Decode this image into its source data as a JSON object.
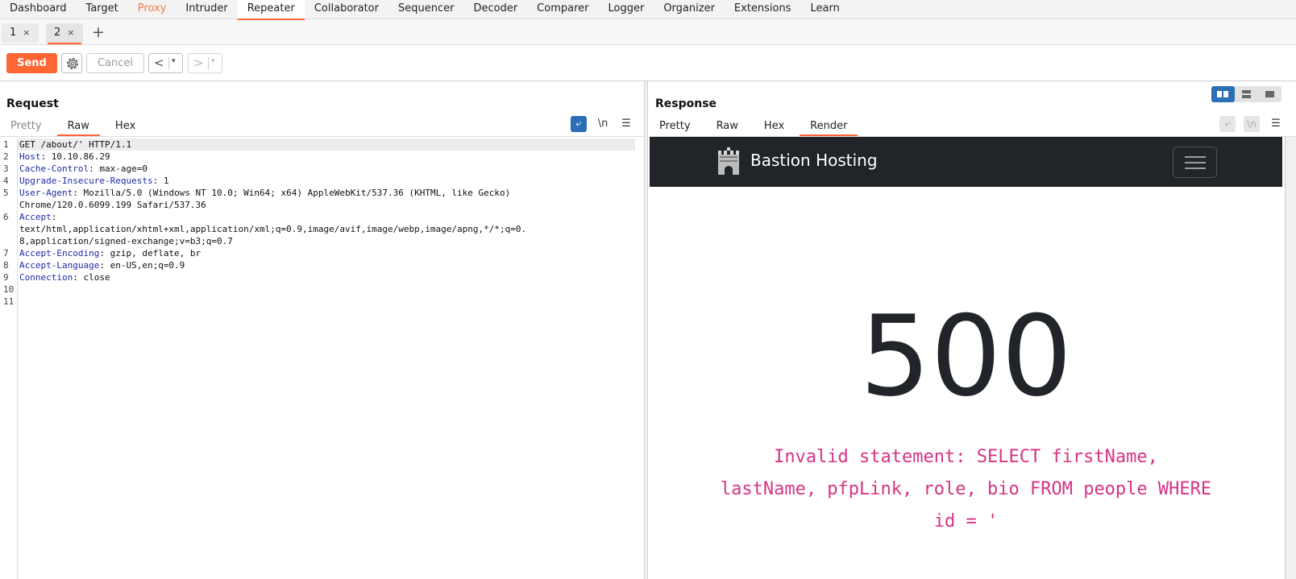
{
  "menu": [
    "Dashboard",
    "Target",
    "Proxy",
    "Intruder",
    "Repeater",
    "Collaborator",
    "Sequencer",
    "Decoder",
    "Comparer",
    "Logger",
    "Organizer",
    "Extensions",
    "Learn"
  ],
  "request_tabs": [
    {
      "label": "1",
      "close": "×"
    },
    {
      "label": "2",
      "close": "×"
    }
  ],
  "add_tab": "+",
  "toolbar": {
    "send": "Send",
    "cancel": "Cancel",
    "back": "<",
    "forward": ">",
    "drop": "▾"
  },
  "request": {
    "title": "Request",
    "tabs": [
      "Pretty",
      "Raw",
      "Hex"
    ],
    "newline_label": "\\n",
    "menu_icon": "☰",
    "lines": [
      {
        "n": "1",
        "name": "",
        "value": "GET /about/' HTTP/1.1"
      },
      {
        "n": "2",
        "name": "Host",
        "value": ": 10.10.86.29"
      },
      {
        "n": "3",
        "name": "Cache-Control",
        "value": ": max-age=0"
      },
      {
        "n": "4",
        "name": "Upgrade-Insecure-Requests",
        "value": ": 1"
      },
      {
        "n": "5",
        "name": "User-Agent",
        "value": ": Mozilla/5.0 (Windows NT 10.0; Win64; x64) AppleWebKit/537.36 (KHTML, like Gecko)"
      },
      {
        "n": "",
        "name": "",
        "value": "Chrome/120.0.6099.199 Safari/537.36"
      },
      {
        "n": "6",
        "name": "Accept",
        "value": ":"
      },
      {
        "n": "",
        "name": "",
        "value": "text/html,application/xhtml+xml,application/xml;q=0.9,image/avif,image/webp,image/apng,*/*;q=0."
      },
      {
        "n": "",
        "name": "",
        "value": "8,application/signed-exchange;v=b3;q=0.7"
      },
      {
        "n": "7",
        "name": "Accept-Encoding",
        "value": ": gzip, deflate, br"
      },
      {
        "n": "8",
        "name": "Accept-Language",
        "value": ": en-US,en;q=0.9"
      },
      {
        "n": "9",
        "name": "Connection",
        "value": ": close"
      },
      {
        "n": "10",
        "name": "",
        "value": ""
      },
      {
        "n": "11",
        "name": "",
        "value": ""
      }
    ]
  },
  "response": {
    "title": "Response",
    "tabs": [
      "Pretty",
      "Raw",
      "Hex",
      "Render"
    ],
    "newline_label": "\\n",
    "menu_icon": "☰",
    "render": {
      "brand": "Bastion Hosting",
      "status_code": "500",
      "error_lines": [
        "Invalid statement: SELECT firstName,",
        "lastName, pfpLink, role, bio FROM people WHERE",
        "id = '"
      ]
    }
  },
  "colors": {
    "accent": "#ff6633",
    "proxy_highlight": "#ee7b4a",
    "header_name": "#1f2aa6",
    "error_pink": "#d63384",
    "navbar": "#212529",
    "toggle_blue": "#2c6fb4"
  }
}
